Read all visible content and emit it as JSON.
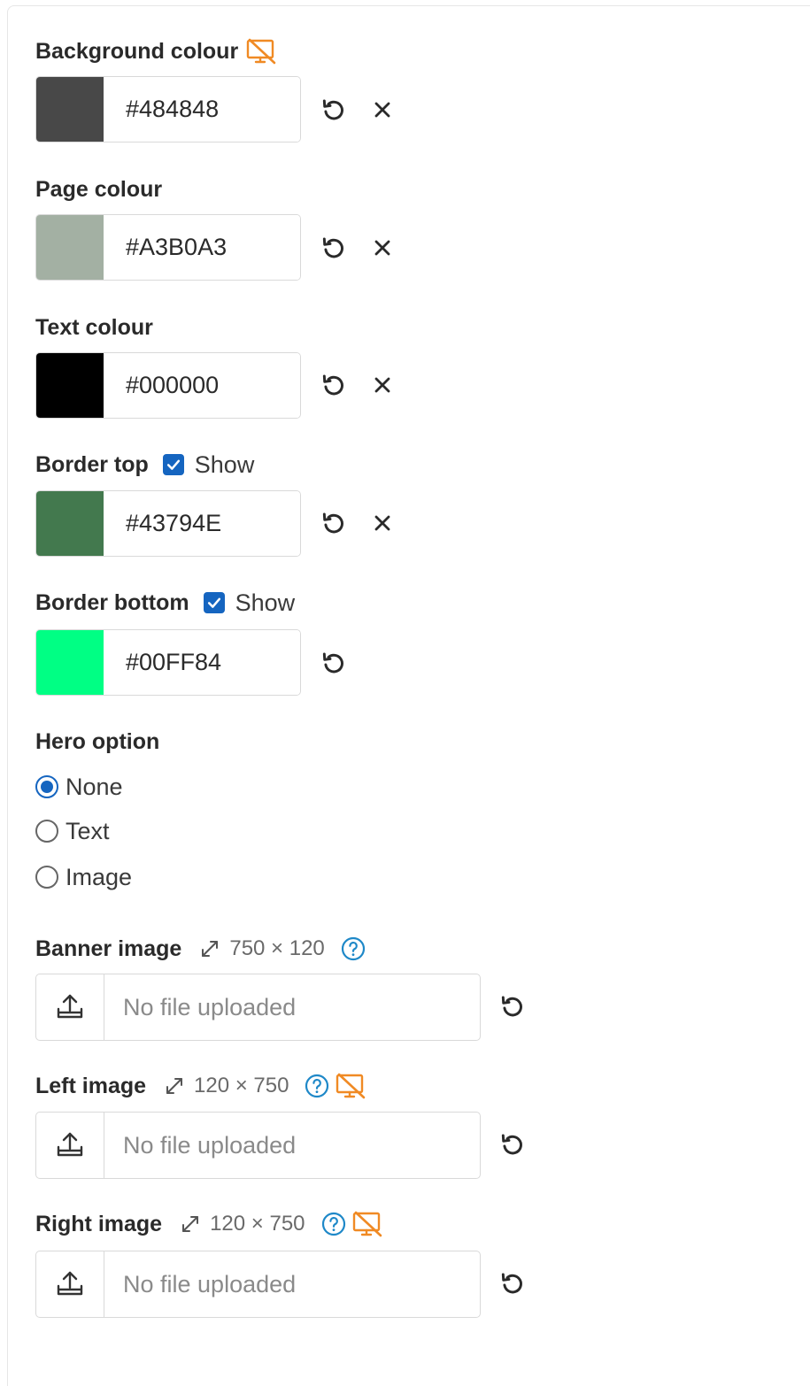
{
  "colors": {
    "background": {
      "label": "Background colour",
      "value": "#484848",
      "swatch": "#484848"
    },
    "page": {
      "label": "Page colour",
      "value": "#A3B0A3",
      "swatch": "#A3B0A3"
    },
    "text": {
      "label": "Text colour",
      "value": "#000000",
      "swatch": "#000000"
    },
    "border_top": {
      "label": "Border top",
      "show_label": "Show",
      "show_checked": true,
      "value": "#43794E",
      "swatch": "#43794E"
    },
    "border_bottom": {
      "label": "Border bottom",
      "show_label": "Show",
      "show_checked": true,
      "value": "#00FF84",
      "swatch": "#00FF84"
    }
  },
  "hero": {
    "label": "Hero option",
    "options": [
      "None",
      "Text",
      "Image"
    ],
    "selected": "None"
  },
  "images": {
    "banner": {
      "label": "Banner image",
      "dims": "750 × 120",
      "status": "No file uploaded"
    },
    "left": {
      "label": "Left image",
      "dims": "120 × 750",
      "status": "No file uploaded"
    },
    "right": {
      "label": "Right image",
      "dims": "120 × 750",
      "status": "No file uploaded"
    }
  },
  "theme": {
    "accent": "#1565c0",
    "warning": "#f08a24",
    "help": "#1e88c8"
  }
}
